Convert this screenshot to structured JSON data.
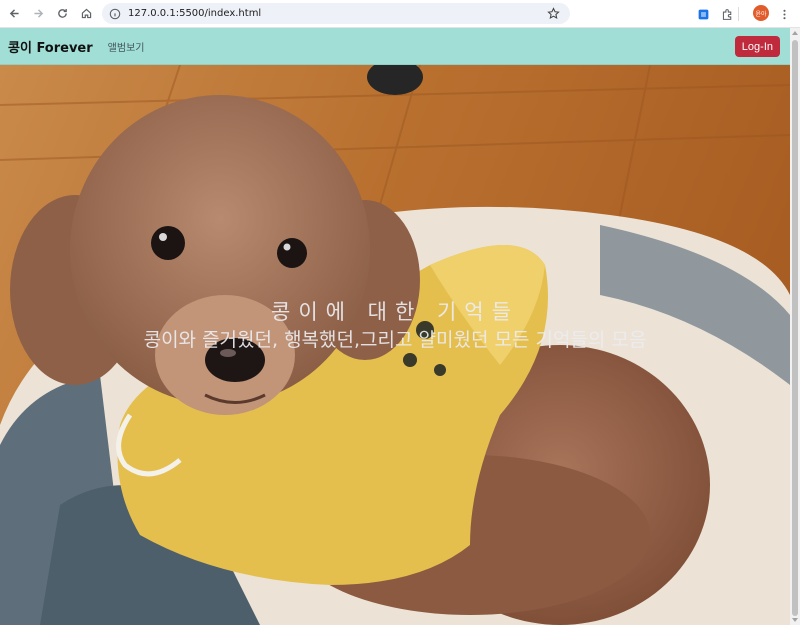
{
  "browser": {
    "url": "127.0.0.1:5500/index.html",
    "profile_initial": "윤아"
  },
  "navbar": {
    "brand": "콩이 Forever",
    "links": [
      {
        "label": "앨범보기"
      }
    ],
    "login_label": "Log-In",
    "colors": {
      "background": "#a0ded6",
      "login": "#bf2a3c"
    }
  },
  "hero": {
    "title": "콩이에 대한 기억들",
    "subtitle": "콩이와 즐거웠던, 행복했던,그리고 얄미웠던 모든 기억들의 모음"
  }
}
